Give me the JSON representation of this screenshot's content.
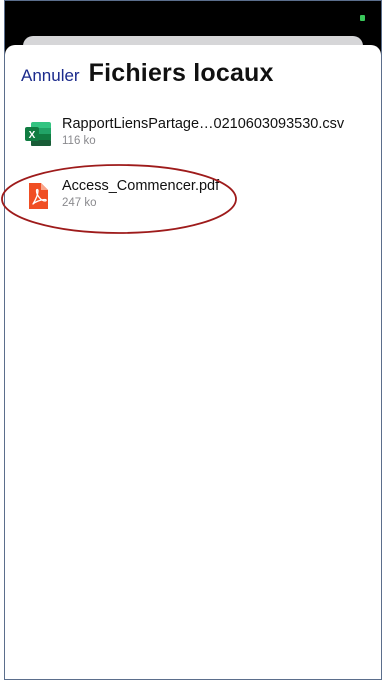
{
  "header": {
    "cancel_label": "Annuler",
    "title": "Fichiers locaux"
  },
  "files": [
    {
      "name": "RapportLiensPartage…0210603093530.csv",
      "size": "116 ko",
      "icon": "excel-icon",
      "icon_color": "#1f7244"
    },
    {
      "name": "Access_Commencer.pdf",
      "size": "247 ko",
      "icon": "pdf-icon",
      "icon_color": "#f04e23"
    }
  ],
  "colors": {
    "accent": "#1b2a8c",
    "annotation": "#9e1b1b",
    "status_battery": "#39c75a"
  }
}
